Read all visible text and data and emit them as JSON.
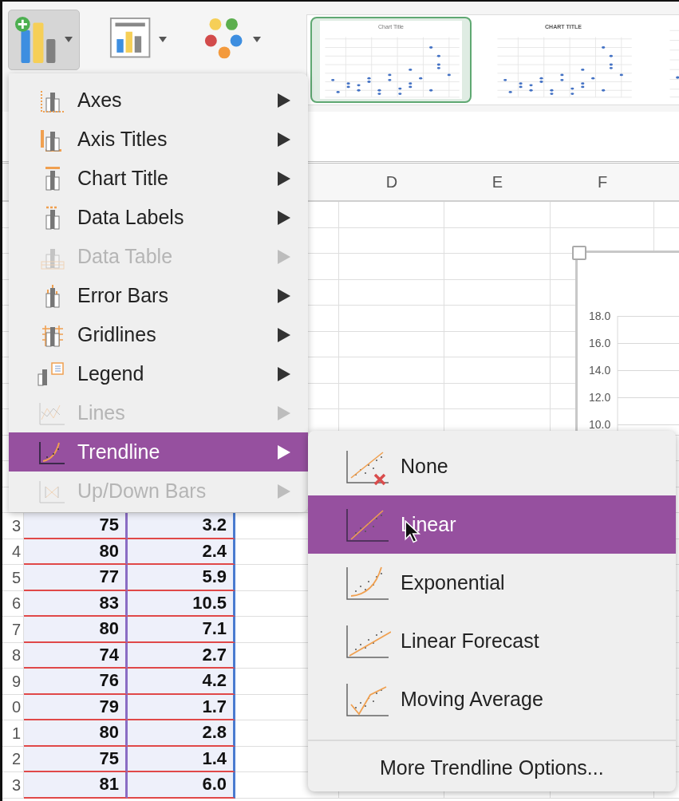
{
  "ribbon": {
    "buttons": [
      {
        "kind": "add_element",
        "pressed": true
      },
      {
        "kind": "quick_layout",
        "pressed": false
      },
      {
        "kind": "colors",
        "pressed": false
      }
    ],
    "style_gallery": [
      {
        "title": "Chart Title",
        "selected": true
      },
      {
        "title": "CHART TITLE",
        "selected": false
      },
      {
        "selected": false
      }
    ]
  },
  "sheet": {
    "column_headers": [
      "D",
      "E",
      "F"
    ],
    "rows": [
      {
        "row_header": "3",
        "column_1": "75",
        "column_2": "3.2"
      },
      {
        "row_header": "4",
        "column_1": "80",
        "column_2": "2.4"
      },
      {
        "row_header": "5",
        "column_1": "77",
        "column_2": "5.9"
      },
      {
        "row_header": "6",
        "column_1": "83",
        "column_2": "10.5"
      },
      {
        "row_header": "7",
        "column_1": "80",
        "column_2": "7.1"
      },
      {
        "row_header": "8",
        "column_1": "74",
        "column_2": "2.7"
      },
      {
        "row_header": "9",
        "column_1": "76",
        "column_2": "4.2"
      },
      {
        "row_header": "0",
        "column_1": "79",
        "column_2": "1.7"
      },
      {
        "row_header": "1",
        "column_1": "80",
        "column_2": "2.8"
      },
      {
        "row_header": "2",
        "column_1": "75",
        "column_2": "1.4"
      },
      {
        "row_header": "3",
        "column_1": "81",
        "column_2": "6.0"
      }
    ]
  },
  "chart_object": {
    "axis_labels": [
      "18.0",
      "16.0",
      "14.0",
      "12.0",
      "10.0"
    ]
  },
  "menu": {
    "items": [
      {
        "label": "Axes",
        "disabled": false,
        "selected": false
      },
      {
        "label": "Axis Titles",
        "disabled": false,
        "selected": false
      },
      {
        "label": "Chart Title",
        "disabled": false,
        "selected": false
      },
      {
        "label": "Data Labels",
        "disabled": false,
        "selected": false
      },
      {
        "label": "Data Table",
        "disabled": true,
        "selected": false
      },
      {
        "label": "Error Bars",
        "disabled": false,
        "selected": false
      },
      {
        "label": "Gridlines",
        "disabled": false,
        "selected": false
      },
      {
        "label": "Legend",
        "disabled": false,
        "selected": false
      },
      {
        "label": "Lines",
        "disabled": true,
        "selected": false
      },
      {
        "label": "Trendline",
        "disabled": false,
        "selected": true
      },
      {
        "label": "Up/Down Bars",
        "disabled": true,
        "selected": false
      }
    ]
  },
  "submenu": {
    "items": [
      {
        "label": "None",
        "selected": false
      },
      {
        "label": "Linear",
        "selected": true
      },
      {
        "label": "Exponential",
        "selected": false
      },
      {
        "label": "Linear Forecast",
        "selected": false
      },
      {
        "label": "Moving Average",
        "selected": false
      }
    ],
    "footer": "More Trendline Options..."
  }
}
